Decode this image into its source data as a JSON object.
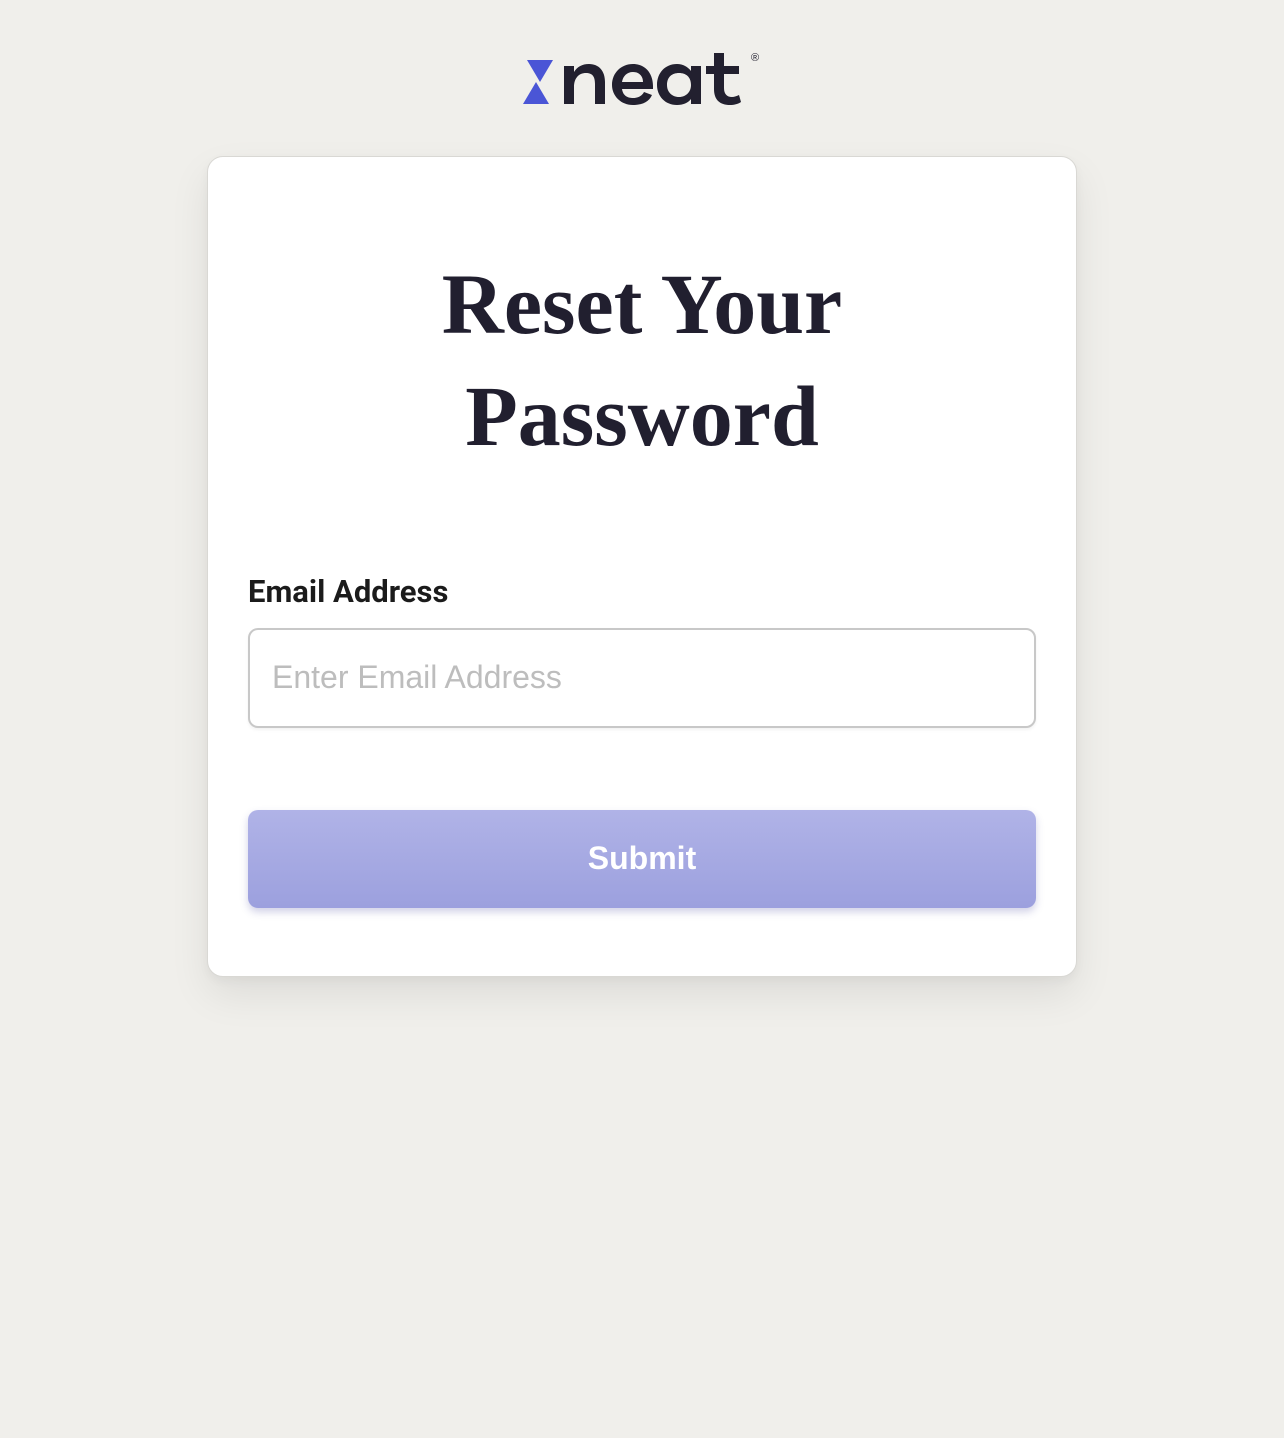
{
  "brand": {
    "name": "neat",
    "accent_color": "#4a55d6",
    "text_color": "#22202f"
  },
  "page": {
    "title": "Reset Your Password"
  },
  "form": {
    "email_label": "Email Address",
    "email_placeholder": "Enter Email Address",
    "email_value": "",
    "submit_label": "Submit"
  }
}
